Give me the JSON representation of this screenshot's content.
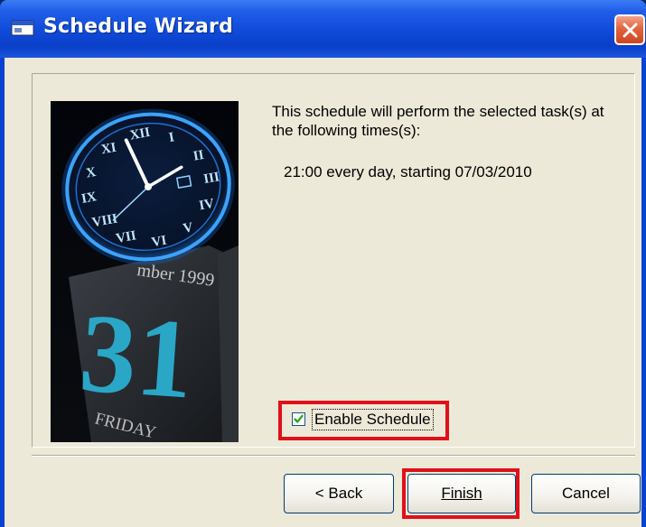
{
  "window": {
    "title": "Schedule Wizard",
    "title_icon": "app-window-icon",
    "close_icon": "close-icon"
  },
  "content": {
    "description": "This schedule will perform the selected task(s) at the following times(s):",
    "schedule_line": "21:00 every day, starting 07/03/2010",
    "image": {
      "name": "clock-calendar-image",
      "calendar_month_partial": "mber 1999",
      "calendar_day": "31",
      "calendar_weekday": "FRIDAY"
    },
    "enable_schedule": {
      "label": "Enable Schedule",
      "checked": true
    }
  },
  "buttons": {
    "back": "< Back",
    "finish": "Finish",
    "cancel": "Cancel"
  },
  "highlights": {
    "color": "#e0101a",
    "targets": [
      "enable-schedule-checkbox",
      "finish-button"
    ]
  },
  "colors": {
    "titlebar": "#0a3fc8",
    "dialog_background": "#ece9d8",
    "close_button": "#e2643f"
  }
}
